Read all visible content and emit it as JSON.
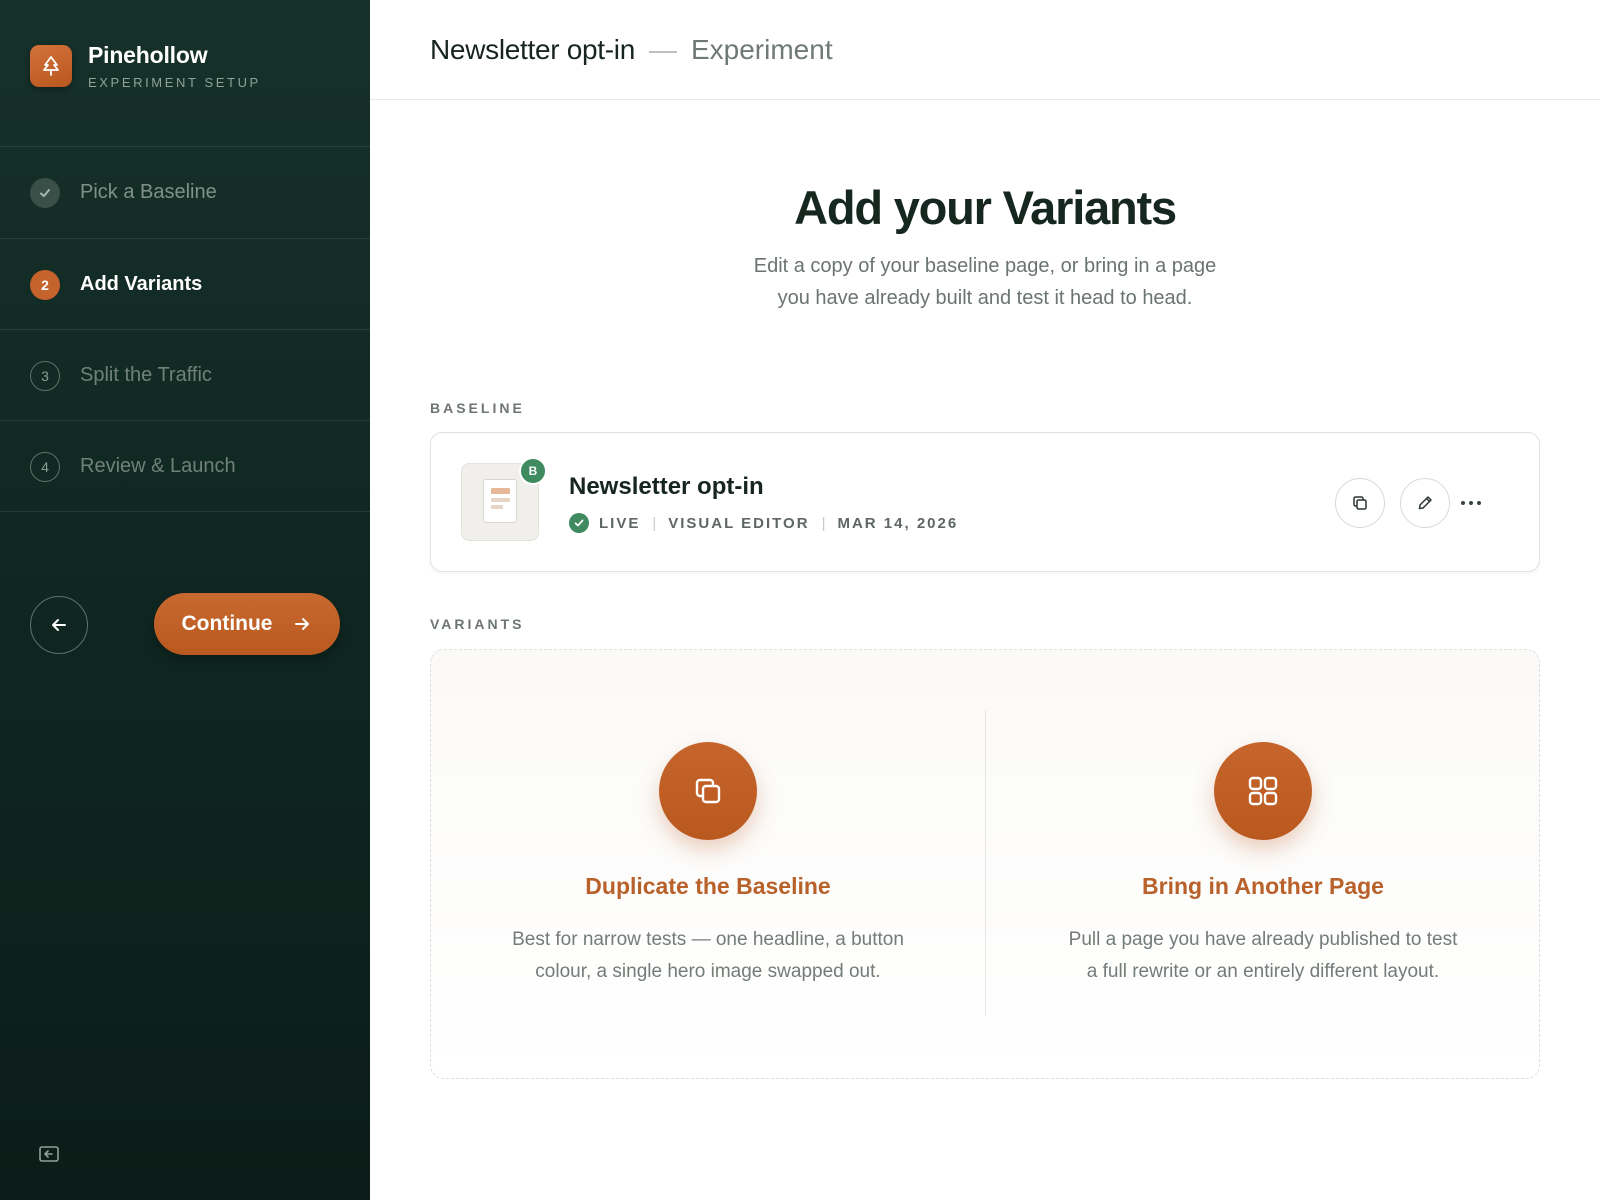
{
  "brand": {
    "name": "Pinehollow",
    "subtitle": "EXPERIMENT SETUP"
  },
  "steps": [
    {
      "label": "Pick a Baseline",
      "number": "",
      "state": "done"
    },
    {
      "label": "Add Variants",
      "number": "2",
      "state": "active"
    },
    {
      "label": "Split the Traffic",
      "number": "3",
      "state": "todo"
    },
    {
      "label": "Review & Launch",
      "number": "4",
      "state": "todo"
    }
  ],
  "nav": {
    "continue_label": "Continue",
    "back_icon": "arrow-left-icon",
    "collapse_icon": "collapse-sidebar-icon"
  },
  "header": {
    "title": "Newsletter opt-in",
    "separator": "—",
    "subtitle": "Experiment"
  },
  "hero": {
    "title": "Add your Variants",
    "description_lines": [
      "Edit a copy of your baseline page, or bring in a page",
      "you have already built and test it head to head."
    ]
  },
  "baseline": {
    "section_label": "BASELINE",
    "badge": "B",
    "title": "Newsletter opt-in",
    "status": "LIVE",
    "editor": "VISUAL EDITOR",
    "date": "MAR 14, 2026"
  },
  "variants": {
    "section_label": "VARIANTS",
    "options": [
      {
        "title": "Duplicate the Baseline",
        "icon": "duplicate-icon",
        "description_lines": [
          "Best for narrow tests — one headline, a button",
          "colour, a single hero image swapped out."
        ]
      },
      {
        "title": "Bring in Another Page",
        "icon": "grid-icon",
        "description_lines": [
          "Pull a page you have already published to test",
          "a full rewrite or an entirely different layout."
        ]
      }
    ]
  },
  "colors": {
    "sidebar": "#12291f",
    "accent": "#c4632b",
    "success": "#3f8a5e",
    "variant_title": "#b8612a"
  }
}
